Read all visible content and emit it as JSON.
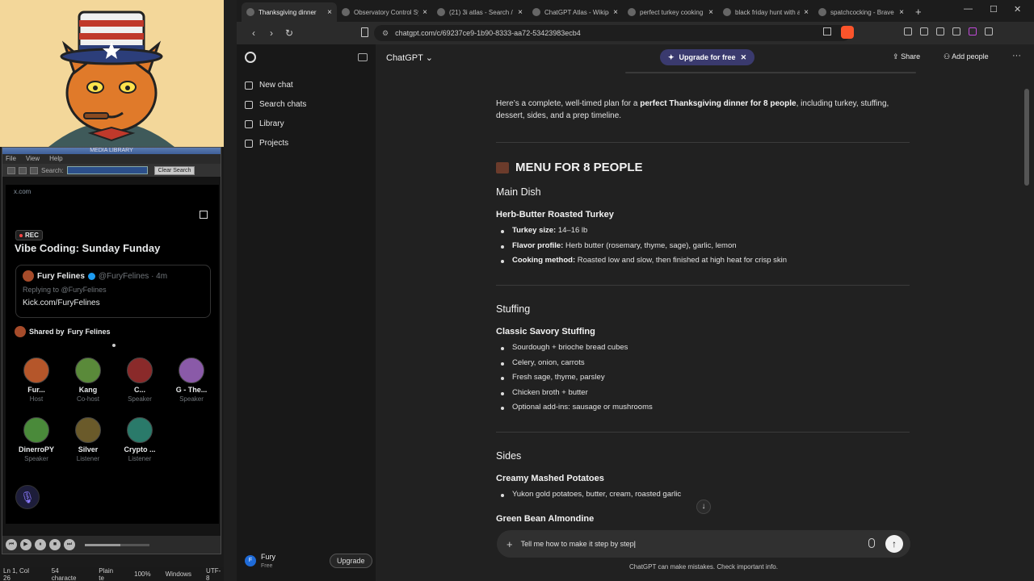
{
  "left": {
    "media_library": {
      "title": "MEDIA LIBRARY",
      "menu": [
        "File",
        "View",
        "Help"
      ],
      "search_label": "Search:",
      "clear_search": "Clear Search"
    },
    "x_space": {
      "url": "x.com",
      "rec": "REC",
      "title": "Vibe Coding: Sunday Funday",
      "tweet": {
        "author": "Fury Felines",
        "handle": "@FuryFelines · 4m",
        "reply": "Replying to @FuryFelines",
        "link": "Kick.com/FuryFelines"
      },
      "shared_by": "Shared by",
      "shared_name": "Fury Felines",
      "people": [
        {
          "name": "Fur...",
          "role": "Host",
          "color": "#b5562a"
        },
        {
          "name": "Kang",
          "role": "Co-host",
          "color": "#5a8a3a"
        },
        {
          "name": "C...",
          "role": "Speaker",
          "color": "#8a2a2a"
        },
        {
          "name": "G - The...",
          "role": "Speaker",
          "color": "#8a5aa8"
        },
        {
          "name": "DinerroPY",
          "role": "Speaker",
          "color": "#4a8a3a"
        },
        {
          "name": "Silver",
          "role": "Listener",
          "color": "#6a5a2a"
        },
        {
          "name": "Crypto ...",
          "role": "Listener",
          "color": "#2a7a6a"
        }
      ],
      "progress": 0.55
    },
    "status": [
      "Ln 1, Col 26",
      "54 characte",
      "Plain te",
      "100%",
      "Windows",
      "UTF-8"
    ]
  },
  "browser": {
    "tabs": [
      {
        "label": "Thanksgiving dinner",
        "active": true
      },
      {
        "label": "Observatory Control Sys",
        "active": false
      },
      {
        "label": "(21) 3i atlas - Search / X",
        "active": false
      },
      {
        "label": "ChatGPT Atlas - Wikipec",
        "active": false
      },
      {
        "label": "perfect turkey cooking w",
        "active": false
      },
      {
        "label": "black friday hunt with a",
        "active": false
      },
      {
        "label": "spatchcocking - Brave S",
        "active": false
      }
    ],
    "url": "chatgpt.com/c/69237ce9-1b90-8333-aa72-53423983ecb4"
  },
  "chatgpt": {
    "sidebar": {
      "items": [
        "New chat",
        "Search chats",
        "Library",
        "Projects"
      ],
      "user_name": "Fury",
      "user_plan": "Free",
      "user_initial": "F",
      "upgrade": "Upgrade"
    },
    "header": {
      "model": "ChatGPT",
      "upgrade_pill": "Upgrade for free",
      "share": "Share",
      "add_people": "Add people"
    },
    "content": {
      "intro_a": "Here’s a complete, well-timed plan for a ",
      "intro_b": "perfect Thanksgiving dinner for 8 people",
      "intro_c": ", including turkey, stuffing, dessert, sides, and a prep timeline.",
      "menu_heading": "MENU FOR 8 PEOPLE",
      "main_dish": "Main Dish",
      "turkey_title": "Herb-Butter Roasted Turkey",
      "turkey_items": [
        {
          "k": "Turkey size:",
          "v": " 14–16 lb"
        },
        {
          "k": "Flavor profile:",
          "v": " Herb butter (rosemary, thyme, sage), garlic, lemon"
        },
        {
          "k": "Cooking method:",
          "v": " Roasted low and slow, then finished at high heat for crisp skin"
        }
      ],
      "stuffing": "Stuffing",
      "stuffing_title": "Classic Savory Stuffing",
      "stuffing_items": [
        "Sourdough + brioche bread cubes",
        "Celery, onion, carrots",
        "Fresh sage, thyme, parsley",
        "Chicken broth + butter",
        "Optional add-ins: sausage or mushrooms"
      ],
      "sides": "Sides",
      "mashed_title": "Creamy Mashed Potatoes",
      "mashed_items": [
        "Yukon gold potatoes, butter, cream, roasted garlic"
      ],
      "green_bean_title": "Green Bean Almondine"
    },
    "composer": {
      "value": "Tell me how to make it step by step",
      "disclaimer": "ChatGPT can make mistakes. Check important info."
    }
  }
}
